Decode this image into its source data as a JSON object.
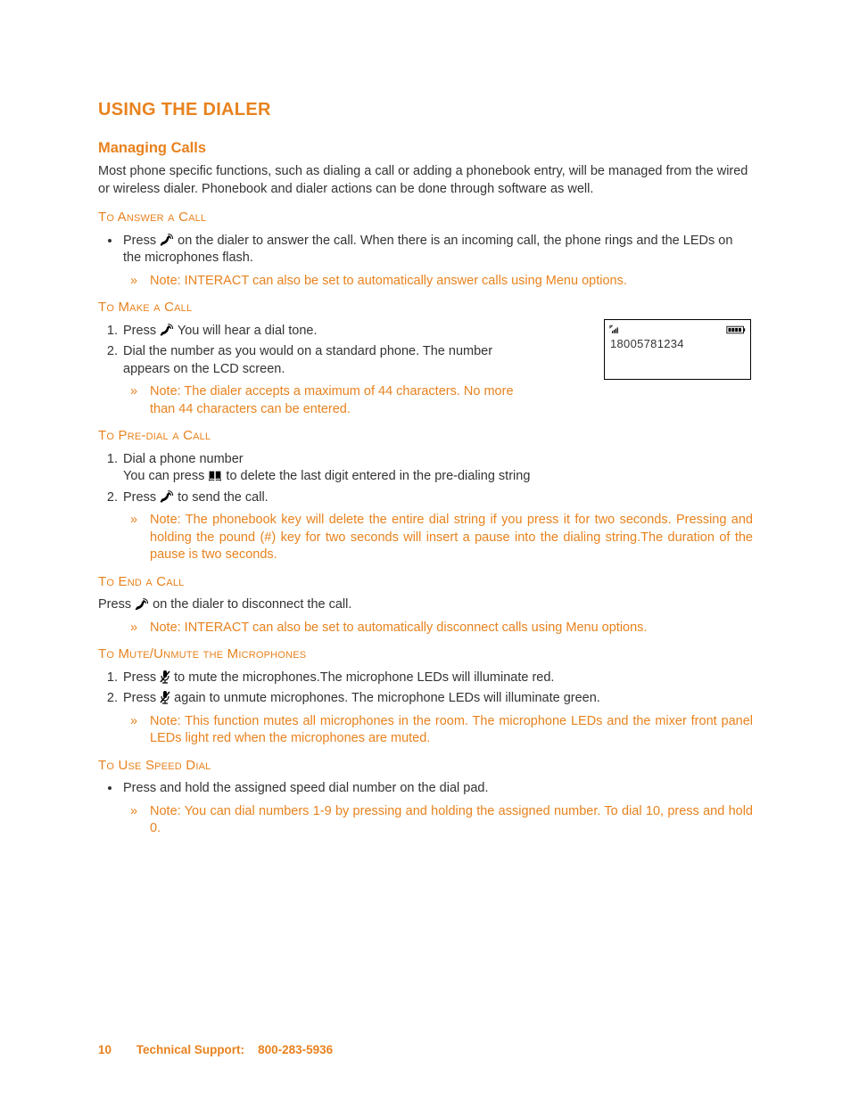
{
  "title": "USING THE DIALER",
  "subtitle": "Managing Calls",
  "intro": "Most phone specific functions, such as dialing a call or adding a phonebook entry, will be managed from the wired or wireless dialer. Phonebook and dialer actions can be done through software as well.",
  "sections": {
    "answer": {
      "heading": "To Answer a Call",
      "bullet_pre": "Press ",
      "bullet_post": " on the dialer to answer the call. When there is an incoming call, the phone rings and the LEDs on the microphones flash.",
      "note": "Note: INTERACT can also be set to automatically answer calls using Menu options."
    },
    "make": {
      "heading": "To Make a Call",
      "step1_pre": "Press ",
      "step1_post": " You will hear a dial tone.",
      "step2": "Dial the number as you would on a standard phone. The number appears on the LCD screen.",
      "note": "Note: The dialer accepts a maximum of 44 characters. No more than 44 characters can be entered."
    },
    "predial": {
      "heading": "To Pre-dial a Call",
      "step1_line1": "Dial a phone number",
      "step1_line2_pre": "You can press ",
      "step1_line2_post": " to delete the last digit entered in the pre-dialing string",
      "step2_pre": "Press ",
      "step2_post": " to send the call.",
      "note": "Note: The phonebook key will delete the entire dial string if you press it for two seconds. Pressing and holding the pound (#) key for two seconds will insert a pause into the dialing string.The duration of the pause is two seconds."
    },
    "end": {
      "heading": "To End a Call",
      "body_pre": "Press ",
      "body_post": " on the dialer to disconnect the call.",
      "note": "Note: INTERACT can also be set to automatically disconnect calls using Menu options."
    },
    "mute": {
      "heading": "To Mute/Unmute the Microphones",
      "step1_pre": "Press ",
      "step1_post": " to mute the microphones.The microphone LEDs will illuminate red.",
      "step2_pre": "Press ",
      "step2_post": " again to unmute microphones. The microphone LEDs will illuminate green.",
      "note": "Note: This function mutes all microphones in the room. The microphone LEDs and the mixer front panel LEDs light red when the microphones are muted."
    },
    "speed": {
      "heading": "To Use Speed Dial",
      "bullet": "Press and hold the assigned speed dial number on the dial pad.",
      "note": "Note: You can dial numbers 1-9 by pressing and holding the assigned number. To dial 10, press and hold 0."
    }
  },
  "lcd": {
    "number": "18005781234"
  },
  "footer": {
    "page": "10",
    "support_label": "Technical Support:",
    "support_number": "800-283-5936"
  }
}
